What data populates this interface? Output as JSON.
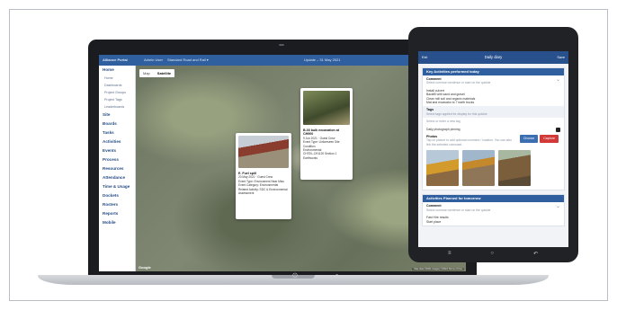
{
  "laptop": {
    "topbar": {
      "brand": "Alliance Portal",
      "admin": "Admin User",
      "project": "Standard Road and Rail ▾",
      "center": "Update – 31 May 2021"
    },
    "sidebar": [
      {
        "label": "Home",
        "sub": false
      },
      {
        "label": "Home",
        "sub": true
      },
      {
        "label": "Dashboards",
        "sub": true
      },
      {
        "label": "Project Groups",
        "sub": true
      },
      {
        "label": "Project Tags",
        "sub": true
      },
      {
        "label": "Leaderboards",
        "sub": true
      },
      {
        "label": "Site",
        "sub": false
      },
      {
        "label": "Boards",
        "sub": false
      },
      {
        "label": "Tasks",
        "sub": false
      },
      {
        "label": "Activities",
        "sub": false
      },
      {
        "label": "Events",
        "sub": false
      },
      {
        "label": "Process",
        "sub": false
      },
      {
        "label": "Resources",
        "sub": false
      },
      {
        "label": "Attendance",
        "sub": false
      },
      {
        "label": "Time & Usage",
        "sub": false
      },
      {
        "label": "Dockets",
        "sub": false
      },
      {
        "label": "Rosters",
        "sub": false
      },
      {
        "label": "Reports",
        "sub": false
      },
      {
        "label": "Mobile",
        "sub": false
      }
    ],
    "map": {
      "tabs": [
        "Map",
        "Satellite"
      ],
      "google": "Google",
      "attribution": "Map data ©2021 Imagery ©2021 Terms of Use",
      "card1": {
        "title": "B-03 bulk excavation at CH900",
        "date": "9 Jun 2021 · Guest Crew",
        "l1": "Event Type: Unforeseen Site Condition",
        "l2": "Environmental",
        "l3": "CH700–CH1120 Section 1 Earthworks"
      },
      "card2": {
        "title": "E. Fuel spill",
        "date": "20 May 2021 · Guest Crew",
        "l1": "Event Type: Environment Near Miss",
        "l2": "Event Category: Environmental",
        "l3": "Related Activity: SDC & Environmental Assessment"
      }
    }
  },
  "tablet": {
    "header": {
      "exit": "Exit",
      "title": "Daily diary",
      "save": "Save"
    },
    "section1": {
      "title": "Key Activities performed today",
      "comment_label": "Comment",
      "comment_hint": "Select common sentence or start on the quickie",
      "lines": [
        "Install culvert",
        "Backfill with sand and gravel",
        "Clean mill soil and organic materials",
        "Mat and excavator to 7 earth trucks"
      ],
      "tags_label": "Tags",
      "tags_hint": "Select tags applied for display for this quickie",
      "tag_input": "Select or enter a new tag",
      "pinning": "Daily photograph pinning",
      "photos_label": "Photos",
      "photos_hint": "Tap on picture to add optional comment / location. You can also link the selected carrousel.",
      "choose": "Choose",
      "capture": "Capture"
    },
    "section2": {
      "title": "Activities Planned for tomorrow",
      "comment_label": "Comment",
      "comment_hint": "Select common sentence or start on the quickie",
      "lines": [
        "Fast Hire results",
        "Start place"
      ]
    }
  }
}
